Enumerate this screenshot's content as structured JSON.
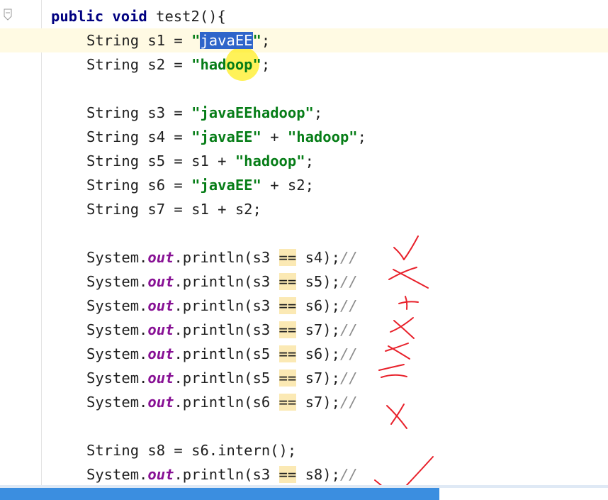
{
  "editor": {
    "lines": [
      {
        "id": "line-method-signature",
        "segments": [
          {
            "text": "public void",
            "style": "kw"
          },
          {
            "text": " test2(){",
            "style": "plain"
          }
        ]
      },
      {
        "id": "line-s1",
        "segments": [
          {
            "text": "String s1 = ",
            "style": "plain"
          },
          {
            "text": "\"",
            "style": "str"
          },
          {
            "text": "javaEE",
            "style": "sel"
          },
          {
            "text": "\"",
            "style": "str"
          },
          {
            "text": ";",
            "style": "plain"
          }
        ]
      },
      {
        "id": "line-s2",
        "segments": [
          {
            "text": "String s2 = ",
            "style": "plain"
          },
          {
            "text": "\"hadoop\"",
            "style": "str"
          },
          {
            "text": ";",
            "style": "plain"
          }
        ]
      },
      {
        "id": "line-s3",
        "segments": [
          {
            "text": "String s3 = ",
            "style": "plain"
          },
          {
            "text": "\"javaEEhadoop\"",
            "style": "str"
          },
          {
            "text": ";",
            "style": "plain"
          }
        ]
      },
      {
        "id": "line-s4",
        "segments": [
          {
            "text": "String s4 = ",
            "style": "plain"
          },
          {
            "text": "\"javaEE\"",
            "style": "str"
          },
          {
            "text": " + ",
            "style": "plain"
          },
          {
            "text": "\"hadoop\"",
            "style": "str"
          },
          {
            "text": ";",
            "style": "plain"
          }
        ]
      },
      {
        "id": "line-s5",
        "segments": [
          {
            "text": "String s5 = s1 + ",
            "style": "plain"
          },
          {
            "text": "\"hadoop\"",
            "style": "str"
          },
          {
            "text": ";",
            "style": "plain"
          }
        ]
      },
      {
        "id": "line-s6",
        "segments": [
          {
            "text": "String s6 = ",
            "style": "plain"
          },
          {
            "text": "\"javaEE\"",
            "style": "str"
          },
          {
            "text": " + s2;",
            "style": "plain"
          }
        ]
      },
      {
        "id": "line-s7",
        "segments": [
          {
            "text": "String s7 = s1 + s2;",
            "style": "plain"
          }
        ]
      },
      {
        "id": "line-print-s3-s4",
        "segments": [
          {
            "text": "System.",
            "style": "plain"
          },
          {
            "text": "out",
            "style": "field"
          },
          {
            "text": ".println(s3 ",
            "style": "plain"
          },
          {
            "text": "==",
            "style": "eqhl"
          },
          {
            "text": " s4);",
            "style": "plain"
          },
          {
            "text": "//",
            "style": "cmt"
          }
        ]
      },
      {
        "id": "line-print-s3-s5",
        "segments": [
          {
            "text": "System.",
            "style": "plain"
          },
          {
            "text": "out",
            "style": "field"
          },
          {
            "text": ".println(s3 ",
            "style": "plain"
          },
          {
            "text": "==",
            "style": "eqhl"
          },
          {
            "text": " s5);",
            "style": "plain"
          },
          {
            "text": "//",
            "style": "cmt"
          }
        ]
      },
      {
        "id": "line-print-s3-s6",
        "segments": [
          {
            "text": "System.",
            "style": "plain"
          },
          {
            "text": "out",
            "style": "field"
          },
          {
            "text": ".println(s3 ",
            "style": "plain"
          },
          {
            "text": "==",
            "style": "eqhl"
          },
          {
            "text": " s6);",
            "style": "plain"
          },
          {
            "text": "//",
            "style": "cmt"
          }
        ]
      },
      {
        "id": "line-print-s3-s7",
        "segments": [
          {
            "text": "System.",
            "style": "plain"
          },
          {
            "text": "out",
            "style": "field"
          },
          {
            "text": ".println(s3 ",
            "style": "plain"
          },
          {
            "text": "==",
            "style": "eqhl"
          },
          {
            "text": " s7);",
            "style": "plain"
          },
          {
            "text": "//",
            "style": "cmt"
          }
        ]
      },
      {
        "id": "line-print-s5-s6",
        "segments": [
          {
            "text": "System.",
            "style": "plain"
          },
          {
            "text": "out",
            "style": "field"
          },
          {
            "text": ".println(s5 ",
            "style": "plain"
          },
          {
            "text": "==",
            "style": "eqhl"
          },
          {
            "text": " s6);",
            "style": "plain"
          },
          {
            "text": "//",
            "style": "cmt"
          }
        ]
      },
      {
        "id": "line-print-s5-s7",
        "segments": [
          {
            "text": "System.",
            "style": "plain"
          },
          {
            "text": "out",
            "style": "field"
          },
          {
            "text": ".println(s5 ",
            "style": "plain"
          },
          {
            "text": "==",
            "style": "eqhl"
          },
          {
            "text": " s7);",
            "style": "plain"
          },
          {
            "text": "//",
            "style": "cmt"
          }
        ]
      },
      {
        "id": "line-print-s6-s7",
        "segments": [
          {
            "text": "System.",
            "style": "plain"
          },
          {
            "text": "out",
            "style": "field"
          },
          {
            "text": ".println(s6 ",
            "style": "plain"
          },
          {
            "text": "==",
            "style": "eqhl"
          },
          {
            "text": " s7);",
            "style": "plain"
          },
          {
            "text": "//",
            "style": "cmt"
          }
        ]
      },
      {
        "id": "line-s8",
        "segments": [
          {
            "text": "String s8 = s6.intern();",
            "style": "plain"
          }
        ]
      },
      {
        "id": "line-print-s3-s8",
        "segments": [
          {
            "text": "System.",
            "style": "plain"
          },
          {
            "text": "out",
            "style": "field"
          },
          {
            "text": ".println(s3 ",
            "style": "plain"
          },
          {
            "text": "==",
            "style": "eqhl"
          },
          {
            "text": " s8);",
            "style": "plain"
          },
          {
            "text": "//",
            "style": "cmt"
          }
        ]
      }
    ]
  },
  "annotations": {
    "marks": [
      "check-mark",
      "cross-mark",
      "cross-mark",
      "cross-mark",
      "cross-mark",
      "cross-mark",
      "cross-mark",
      "check-mark"
    ],
    "ink_color": "#e8202a"
  },
  "colors": {
    "keyword": "#000080",
    "string": "#067d17",
    "field": "#871094",
    "comment": "#8c8c8c",
    "selection": "#2f65ca",
    "current_line": "#fffae3",
    "operator_highlight": "#fbe9b4",
    "cursor_highlight": "#ffeb00"
  }
}
